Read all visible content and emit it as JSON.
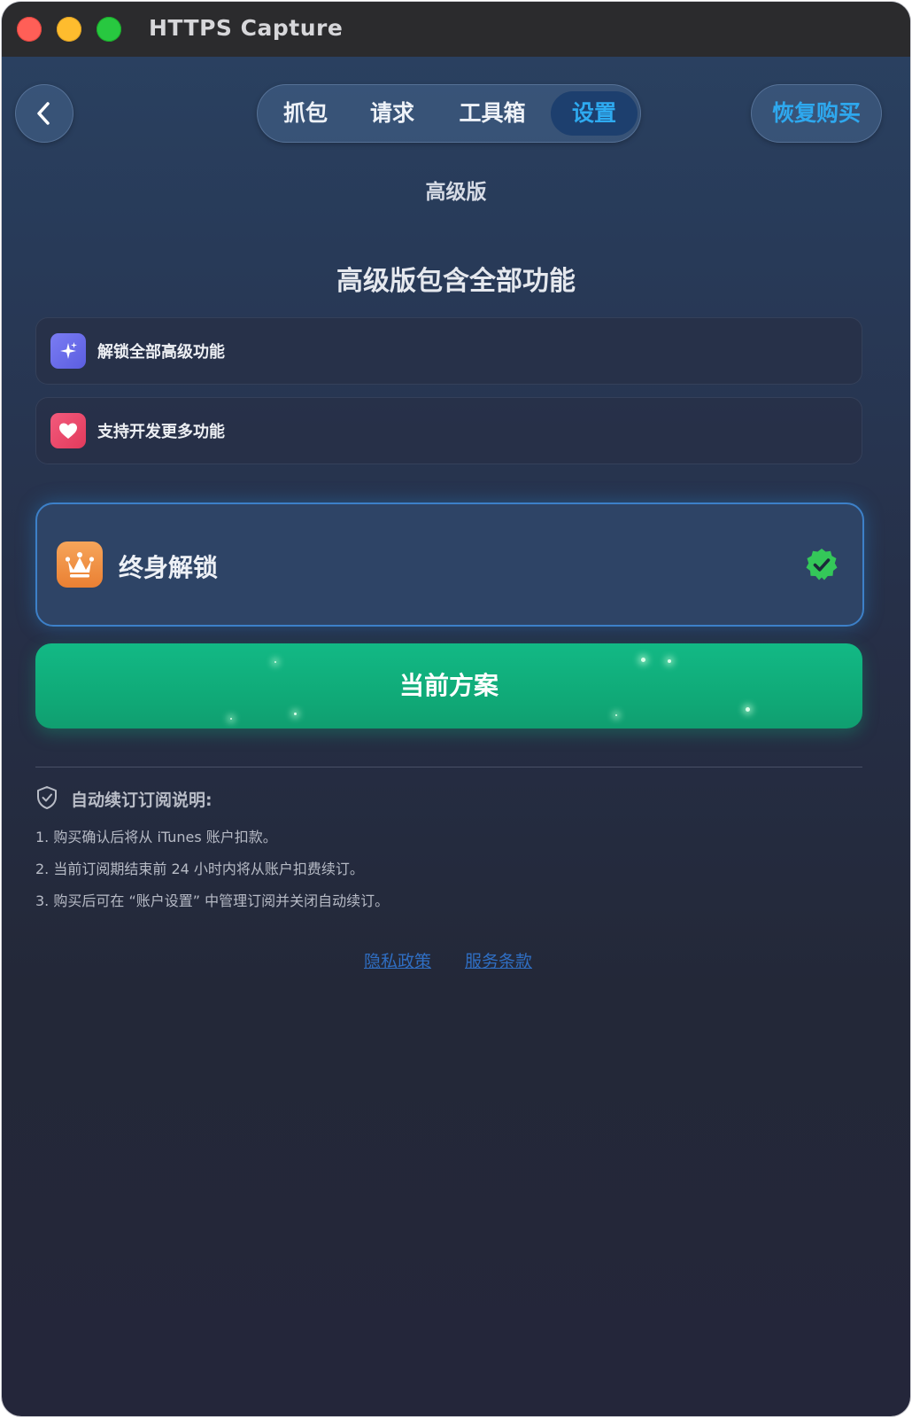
{
  "window": {
    "title": "HTTPS Capture"
  },
  "nav": {
    "tabs": [
      {
        "label": "抓包"
      },
      {
        "label": "请求"
      },
      {
        "label": "工具箱"
      },
      {
        "label": "设置"
      }
    ],
    "active_tab": "设置",
    "restore_label": "恢复购买"
  },
  "page": {
    "subtitle": "高级版",
    "headline": "高级版包含全部功能"
  },
  "features": [
    {
      "label": "解锁全部高级功能",
      "icon": "sparkles-icon",
      "color": "#6b6ef0"
    },
    {
      "label": "支持开发更多功能",
      "icon": "heart-icon",
      "color": "#ea4a6c"
    }
  ],
  "plan": {
    "label": "终身解锁",
    "icon": "crown-icon",
    "selected": true
  },
  "current_button": {
    "label": "当前方案",
    "color": "#12b080"
  },
  "notes": {
    "title": "自动续订订阅说明:",
    "lines": [
      "1. 购买确认后将从 iTunes 账户扣款。",
      "2. 当前订阅期结束前 24 小时内将从账户扣费续订。",
      "3. 购买后可在 “账户设置” 中管理订阅并关闭自动续订。"
    ]
  },
  "links": [
    {
      "label": "隐私政策"
    },
    {
      "label": "服务条款"
    }
  ],
  "colors": {
    "accent": "#2ea8ee",
    "link": "#2f6ec2"
  }
}
